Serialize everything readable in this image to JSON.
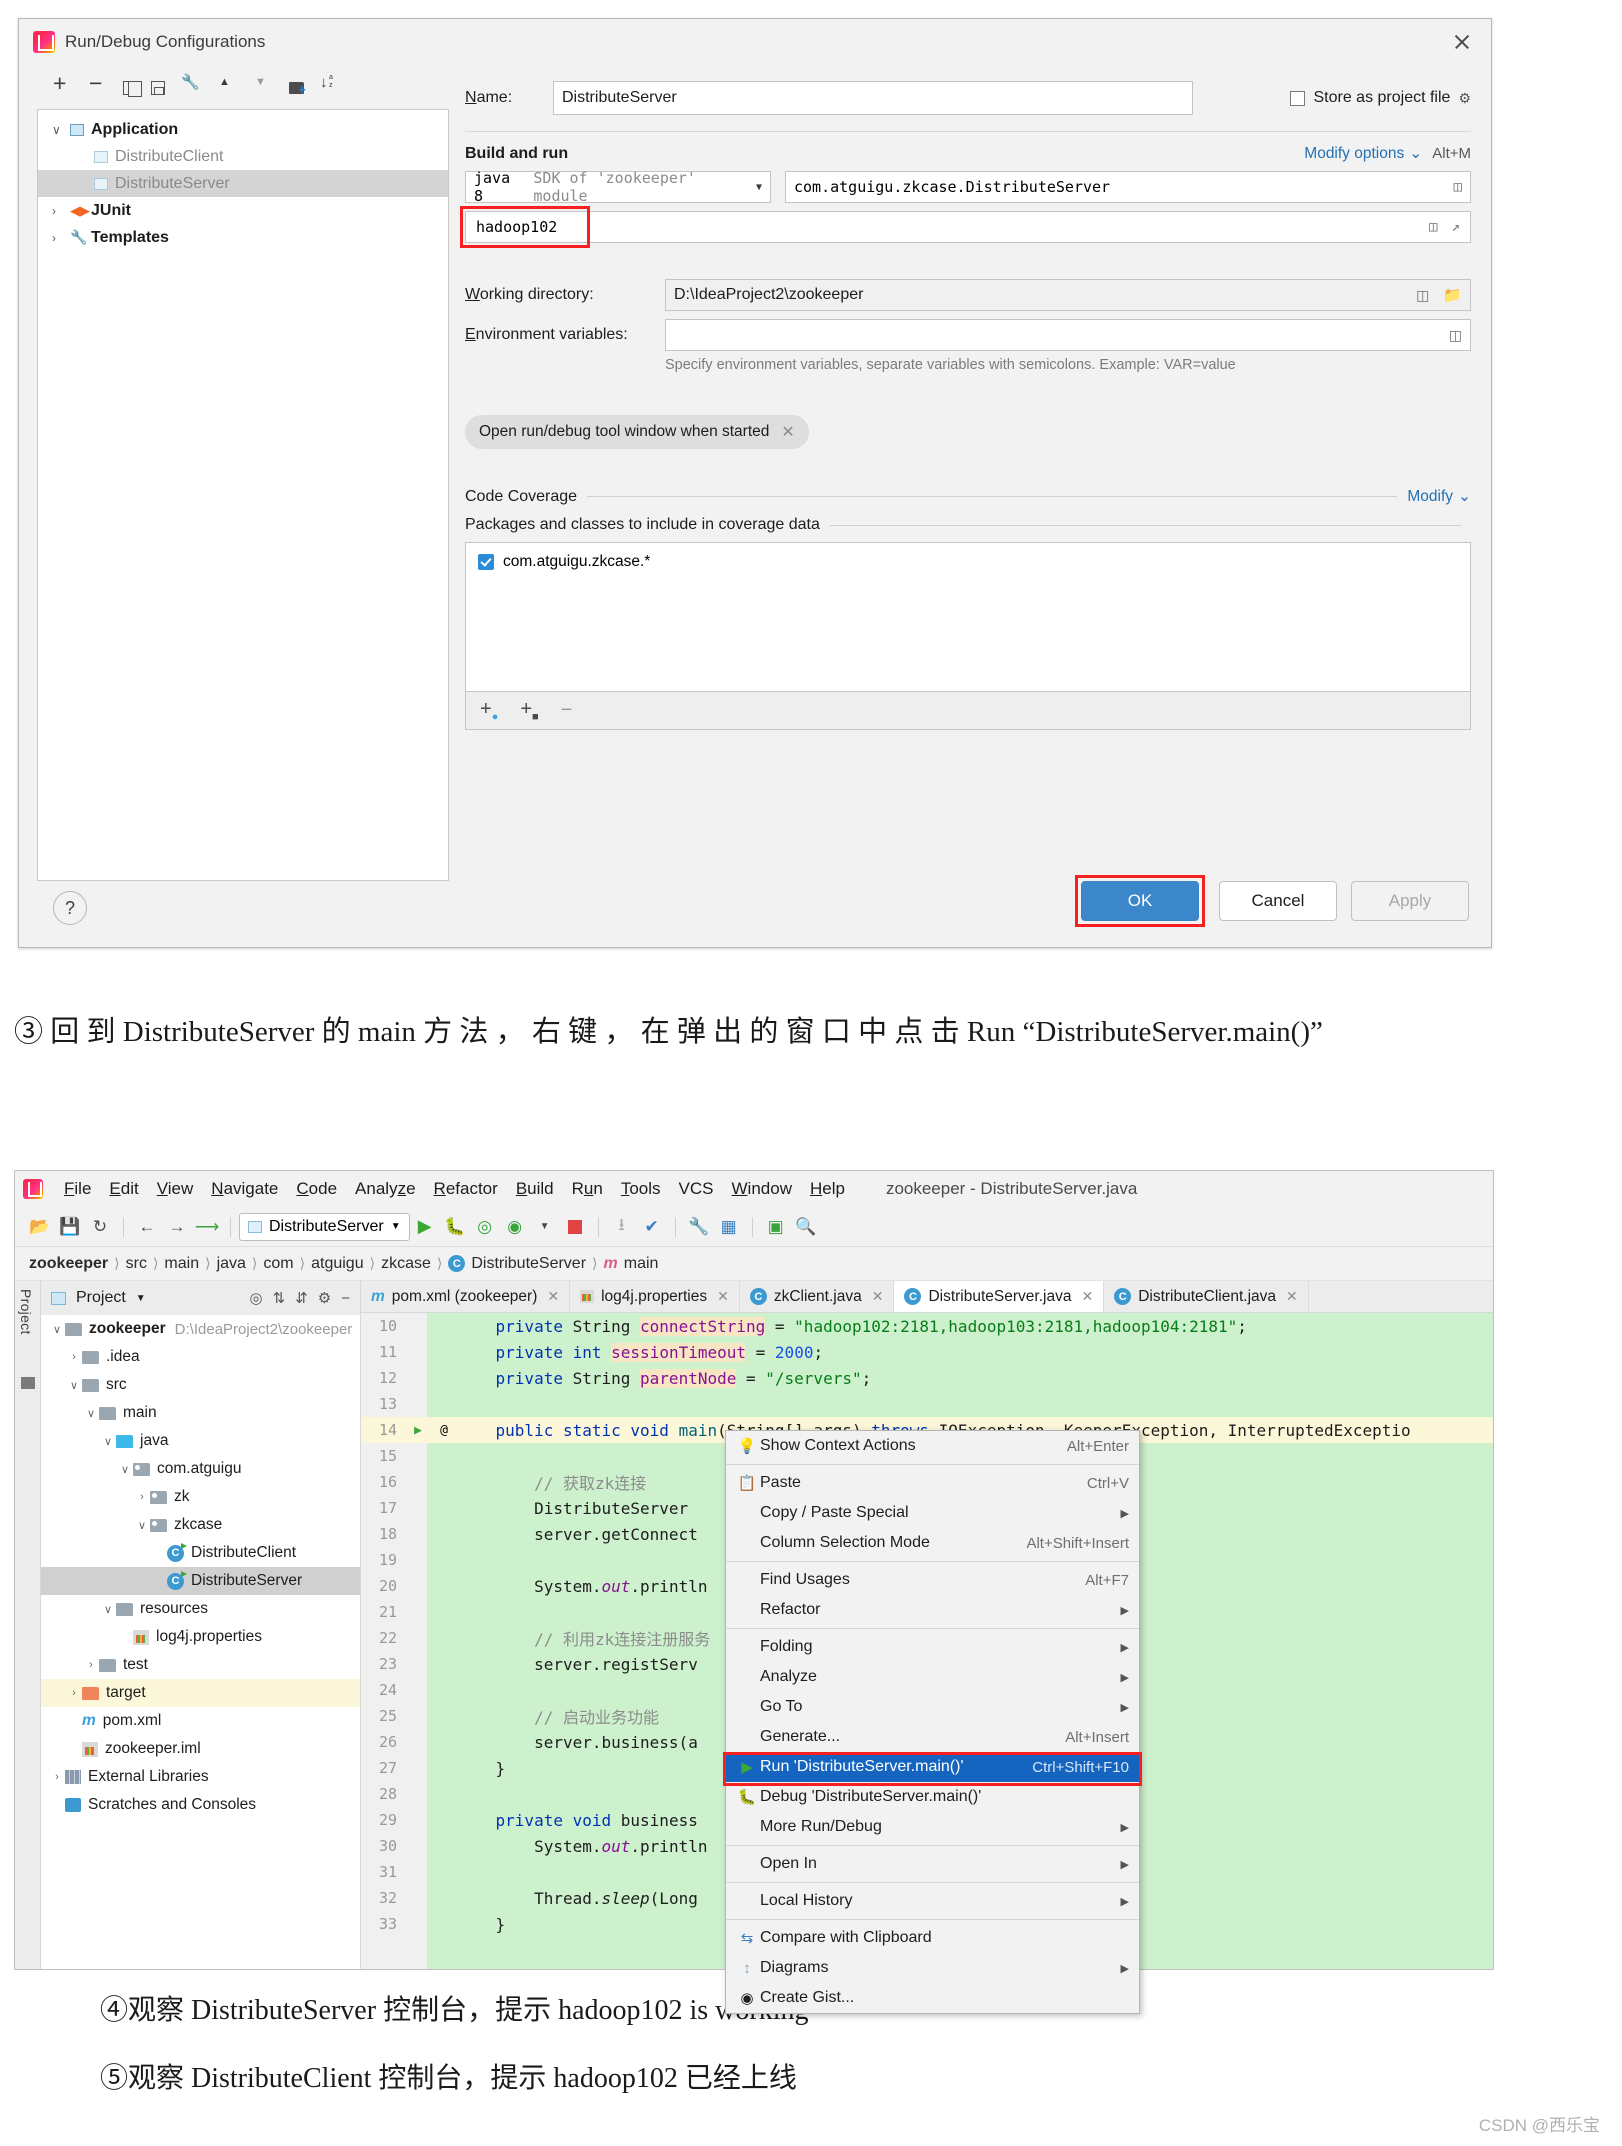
{
  "dialog": {
    "title": "Run/Debug Configurations",
    "toolbar_icons": [
      "add-icon",
      "remove-icon",
      "copy-icon",
      "save-icon",
      "wrench-icon",
      "move-up-icon",
      "move-down-icon",
      "new-folder-icon",
      "sort-alpha-icon"
    ],
    "tree": [
      {
        "label": "Application",
        "bold": true,
        "dim": false,
        "arrow": "∨",
        "icon": "application-icon",
        "selected": false,
        "indent": 0
      },
      {
        "label": "DistributeClient",
        "bold": false,
        "dim": true,
        "arrow": "",
        "icon": "config-icon",
        "selected": false,
        "indent": 1
      },
      {
        "label": "DistributeServer",
        "bold": false,
        "dim": true,
        "arrow": "",
        "icon": "config-icon",
        "selected": true,
        "indent": 1
      },
      {
        "label": "JUnit",
        "bold": true,
        "dim": false,
        "arrow": "›",
        "icon": "junit-icon",
        "selected": false,
        "indent": 0
      },
      {
        "label": "Templates",
        "bold": true,
        "dim": false,
        "arrow": "›",
        "icon": "templates-icon",
        "selected": false,
        "indent": 0
      }
    ],
    "name_label": "Name:",
    "name_value": "DistributeServer",
    "store_as_project_file": "Store as project file",
    "build_and_run": "Build and run",
    "modify_options": "Modify options",
    "modify_options_shortcut": "Alt+M",
    "sdk_value": "java 8",
    "sdk_suffix": "SDK of 'zookeeper' module",
    "main_class": "com.atguigu.zkcase.DistributeServer",
    "program_args": "hadoop102",
    "working_directory_label": "Working directory:",
    "working_directory_value": "D:\\IdeaProject2\\zookeeper",
    "environment_variables_label": "Environment variables:",
    "environment_variables_value": "",
    "env_hint": "Specify environment variables, separate variables with semicolons. Example: VAR=value",
    "chip_label": "Open run/debug tool window when started",
    "code_coverage": "Code Coverage",
    "modify_link": "Modify",
    "packages_label": "Packages and classes to include in coverage data",
    "coverage_items": [
      "com.atguigu.zkcase.*"
    ],
    "coverage_foot_icons": [
      "add-package-icon",
      "add-class-icon",
      "remove-icon"
    ],
    "help_label": "?",
    "buttons": {
      "ok": "OK",
      "cancel": "Cancel",
      "apply": "Apply"
    },
    "close_icon": "close-icon"
  },
  "caption1": "③ 回 到  DistributeServer  的  main  方 法 ， 右 键 ， 在 弹 出 的 窗 口 中 点 击  Run “DistributeServer.main()”",
  "ide": {
    "window_title": "zookeeper - DistributeServer.java",
    "menu": [
      "File",
      "Edit",
      "View",
      "Navigate",
      "Code",
      "Analyze",
      "Refactor",
      "Build",
      "Run",
      "Tools",
      "VCS",
      "Window",
      "Help"
    ],
    "run_config": "DistributeServer",
    "breadcrumbs": [
      "zookeeper",
      "src",
      "main",
      "java",
      "com",
      "atguigu",
      "zkcase",
      "DistributeServer",
      "main"
    ],
    "project_panel_title": "Project",
    "project_tree": [
      {
        "label": "zookeeper",
        "path": "D:\\IdeaProject2\\zookeeper",
        "arrow": "∨",
        "icon": "module-folder-icon",
        "indent": 0,
        "bold": true,
        "state": ""
      },
      {
        "label": ".idea",
        "path": "",
        "arrow": "›",
        "icon": "folder-icon",
        "indent": 1,
        "bold": false,
        "state": ""
      },
      {
        "label": "src",
        "path": "",
        "arrow": "∨",
        "icon": "folder-icon",
        "indent": 1,
        "bold": false,
        "state": ""
      },
      {
        "label": "main",
        "path": "",
        "arrow": "∨",
        "icon": "folder-icon",
        "indent": 2,
        "bold": false,
        "state": ""
      },
      {
        "label": "java",
        "path": "",
        "arrow": "∨",
        "icon": "source-folder-icon",
        "indent": 3,
        "bold": false,
        "state": ""
      },
      {
        "label": "com.atguigu",
        "path": "",
        "arrow": "∨",
        "icon": "package-icon",
        "indent": 4,
        "bold": false,
        "state": ""
      },
      {
        "label": "zk",
        "path": "",
        "arrow": "›",
        "icon": "package-icon",
        "indent": 5,
        "bold": false,
        "state": ""
      },
      {
        "label": "zkcase",
        "path": "",
        "arrow": "∨",
        "icon": "package-icon",
        "indent": 5,
        "bold": false,
        "state": ""
      },
      {
        "label": "DistributeClient",
        "path": "",
        "arrow": "",
        "icon": "java-class-icon",
        "indent": 6,
        "bold": false,
        "state": ""
      },
      {
        "label": "DistributeServer",
        "path": "",
        "arrow": "",
        "icon": "java-class-icon",
        "indent": 6,
        "bold": false,
        "state": "selected"
      },
      {
        "label": "resources",
        "path": "",
        "arrow": "∨",
        "icon": "resources-folder-icon",
        "indent": 3,
        "bold": false,
        "state": ""
      },
      {
        "label": "log4j.properties",
        "path": "",
        "arrow": "",
        "icon": "properties-icon",
        "indent": 4,
        "bold": false,
        "state": ""
      },
      {
        "label": "test",
        "path": "",
        "arrow": "›",
        "icon": "folder-icon",
        "indent": 2,
        "bold": false,
        "state": ""
      },
      {
        "label": "target",
        "path": "",
        "arrow": "›",
        "icon": "target-folder-icon",
        "indent": 1,
        "bold": false,
        "state": "highlight"
      },
      {
        "label": "pom.xml",
        "path": "",
        "arrow": "",
        "icon": "maven-icon",
        "indent": 1,
        "bold": false,
        "state": ""
      },
      {
        "label": "zookeeper.iml",
        "path": "",
        "arrow": "",
        "icon": "iml-icon",
        "indent": 1,
        "bold": false,
        "state": ""
      },
      {
        "label": "External Libraries",
        "path": "",
        "arrow": "›",
        "icon": "library-icon",
        "indent": 0,
        "bold": false,
        "state": ""
      },
      {
        "label": "Scratches and Consoles",
        "path": "",
        "arrow": "",
        "icon": "scratches-icon",
        "indent": 0,
        "bold": false,
        "state": ""
      }
    ],
    "tabs": [
      {
        "label": "pom.xml (zookeeper)",
        "icon": "maven-icon",
        "active": false
      },
      {
        "label": "log4j.properties",
        "icon": "properties-icon",
        "active": false
      },
      {
        "label": "zkClient.java",
        "icon": "java-class-icon",
        "active": false
      },
      {
        "label": "DistributeServer.java",
        "icon": "java-class-icon",
        "active": true
      },
      {
        "label": "DistributeClient.java",
        "icon": "java-class-icon",
        "active": false
      }
    ],
    "code_lines": [
      {
        "n": "10",
        "html": "    <span class='kw'>private</span> String <span class='hl-f fld2'>connectString</span> = <span class='str'>\"hadoop102:2181,hadoop103:2181,hadoop104:2181\"</span>;"
      },
      {
        "n": "11",
        "html": "    <span class='kw'>private</span> <span class='kw'>int</span> <span class='hl-f fld2'>sessionTimeout</span> = <span class='num'>2000</span>;"
      },
      {
        "n": "12",
        "html": "    <span class='kw'>private</span> String <span class='hl-f fld2'>parentNode</span> = <span class='str'>\"/servers\"</span>;"
      },
      {
        "n": "13",
        "html": ""
      },
      {
        "n": "14",
        "html": "    <span class='kw'>public static</span> <span class='kw'>void</span> <span style='color:#00627a'>main</span>(String[] args) <span class='kw'>throws</span> IOException, KeeperException, InterruptedExceptio"
      },
      {
        "n": "15",
        "html": ""
      },
      {
        "n": "16",
        "html": "        <span class='cmt'>// 获取zk连接</span>"
      },
      {
        "n": "17",
        "html": "        DistributeServer"
      },
      {
        "n": "18",
        "html": "        server.getConnect"
      },
      {
        "n": "19",
        "html": ""
      },
      {
        "n": "20",
        "html": "        System.<span style='font-style:italic;color:#871094'>out</span>.println"
      },
      {
        "n": "21",
        "html": ""
      },
      {
        "n": "22",
        "html": "        <span class='cmt'>// 利用zk连接注册服务</span>"
      },
      {
        "n": "23",
        "html": "        server.registServ"
      },
      {
        "n": "24",
        "html": ""
      },
      {
        "n": "25",
        "html": "        <span class='cmt'>// 启动业务功能</span>"
      },
      {
        "n": "26",
        "html": "        server.business(a"
      },
      {
        "n": "27",
        "html": "    }"
      },
      {
        "n": "28",
        "html": ""
      },
      {
        "n": "29",
        "html": "    <span class='kw'>private</span> <span class='kw'>void</span> business<span style='color:#1d1d1d'>    </span>tion {"
      },
      {
        "n": "30",
        "html": "        System.<span style='font-style:italic;color:#871094'>out</span>.println"
      },
      {
        "n": "31",
        "html": ""
      },
      {
        "n": "32",
        "html": "        Thread.<span style='font-style:italic'>sleep</span>(Long"
      },
      {
        "n": "33",
        "html": "    }"
      }
    ],
    "context_menu": [
      {
        "label": "Show Context Actions",
        "key": "Alt+Enter",
        "icon": "lightbulb-icon",
        "arrow": false,
        "sep_after": true,
        "selected": false
      },
      {
        "label": "Paste",
        "key": "Ctrl+V",
        "icon": "clipboard-icon",
        "arrow": false,
        "sep_after": false,
        "selected": false
      },
      {
        "label": "Copy / Paste Special",
        "key": "",
        "icon": "",
        "arrow": true,
        "sep_after": false,
        "selected": false
      },
      {
        "label": "Column Selection Mode",
        "key": "Alt+Shift+Insert",
        "icon": "",
        "arrow": false,
        "sep_after": true,
        "selected": false
      },
      {
        "label": "Find Usages",
        "key": "Alt+F7",
        "icon": "",
        "arrow": false,
        "sep_after": false,
        "selected": false
      },
      {
        "label": "Refactor",
        "key": "",
        "icon": "",
        "arrow": true,
        "sep_after": true,
        "selected": false
      },
      {
        "label": "Folding",
        "key": "",
        "icon": "",
        "arrow": true,
        "sep_after": false,
        "selected": false
      },
      {
        "label": "Analyze",
        "key": "",
        "icon": "",
        "arrow": true,
        "sep_after": false,
        "selected": false
      },
      {
        "label": "Go To",
        "key": "",
        "icon": "",
        "arrow": true,
        "sep_after": false,
        "selected": false
      },
      {
        "label": "Generate...",
        "key": "Alt+Insert",
        "icon": "",
        "arrow": false,
        "sep_after": false,
        "selected": false
      },
      {
        "label": "Run 'DistributeServer.main()'",
        "key": "Ctrl+Shift+F10",
        "icon": "run-icon",
        "arrow": false,
        "sep_after": false,
        "selected": true
      },
      {
        "label": "Debug 'DistributeServer.main()'",
        "key": "",
        "icon": "debug-icon",
        "arrow": false,
        "sep_after": false,
        "selected": false
      },
      {
        "label": "More Run/Debug",
        "key": "",
        "icon": "",
        "arrow": true,
        "sep_after": true,
        "selected": false
      },
      {
        "label": "Open In",
        "key": "",
        "icon": "",
        "arrow": true,
        "sep_after": true,
        "selected": false
      },
      {
        "label": "Local History",
        "key": "",
        "icon": "",
        "arrow": true,
        "sep_after": true,
        "selected": false
      },
      {
        "label": "Compare with Clipboard",
        "key": "",
        "icon": "compare-icon",
        "arrow": false,
        "sep_after": false,
        "selected": false
      },
      {
        "label": "Diagrams",
        "key": "",
        "icon": "diagram-icon",
        "arrow": true,
        "sep_after": false,
        "selected": false
      },
      {
        "label": "Create Gist...",
        "key": "",
        "icon": "github-icon",
        "arrow": false,
        "sep_after": false,
        "selected": false
      }
    ]
  },
  "caption2": "④观察 DistributeServer 控制台，提示 hadoop102 is working",
  "caption3": "⑤观察 DistributeClient 控制台，提示 hadoop102 已经上线",
  "watermark": "CSDN @西乐宝",
  "colors": {
    "accent": "#3b87c9",
    "highlight_red": "#f71f1f",
    "menu_select": "#1565c0",
    "code_bg": "#cdf0cd"
  }
}
